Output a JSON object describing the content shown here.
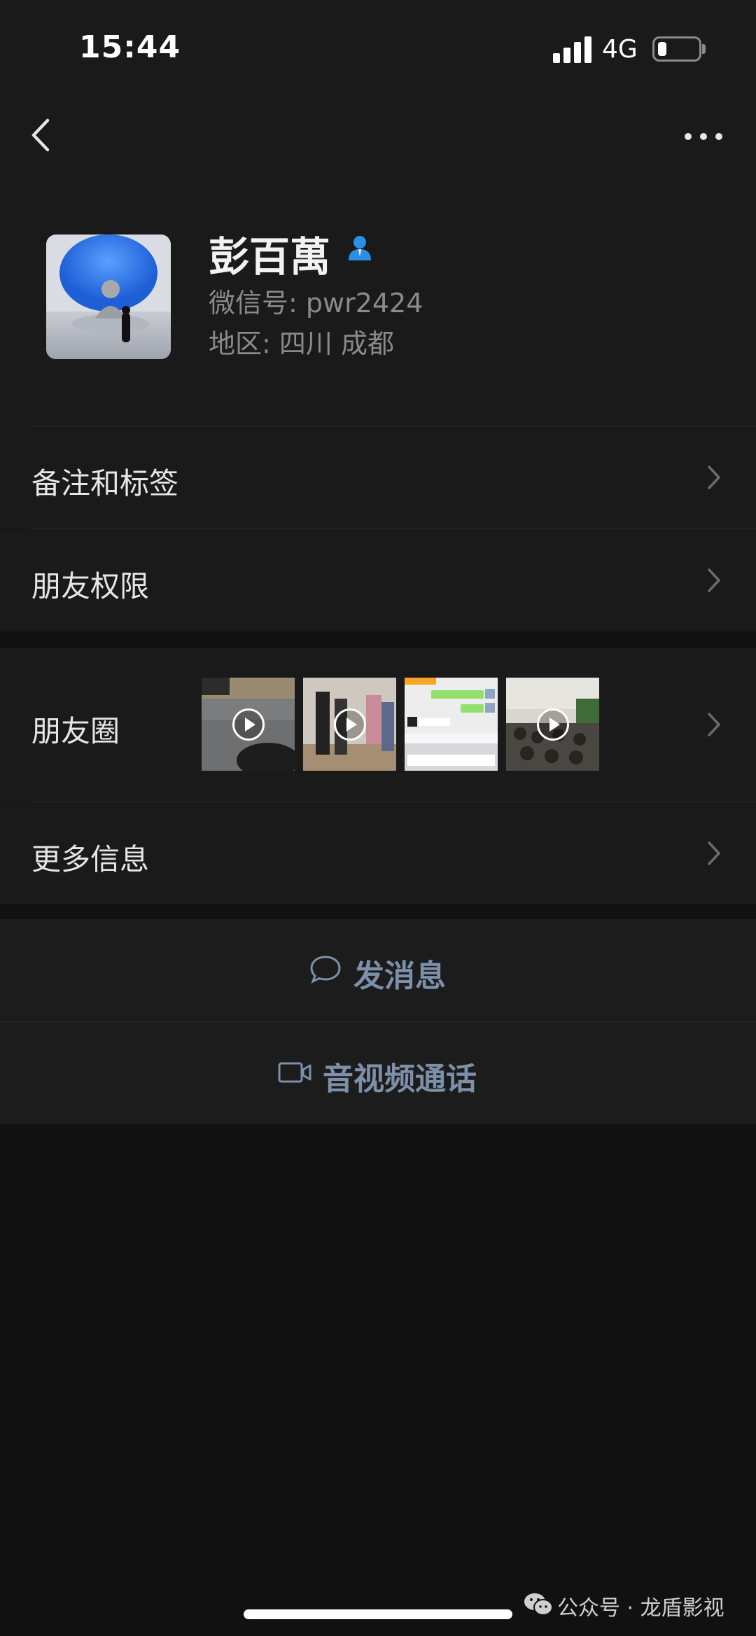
{
  "status_bar": {
    "time": "15:44",
    "network": "4G",
    "battery_level": 0.2
  },
  "profile": {
    "name": "彭百萬",
    "wechat_id": "微信号: pwr2424",
    "region": "地区: 四川 成都"
  },
  "menu": {
    "notes_tags": "备注和标签",
    "friend_permissions": "朋友权限",
    "moments": "朋友圈",
    "more_info": "更多信息"
  },
  "moments_thumbs": [
    {
      "type": "video",
      "icon": "play-icon"
    },
    {
      "type": "video",
      "icon": "play-icon"
    },
    {
      "type": "image",
      "icon": ""
    },
    {
      "type": "video",
      "icon": "play-icon"
    }
  ],
  "actions": {
    "send_message": "发消息",
    "video_call": "音视频通话"
  },
  "watermark": {
    "text": "公众号 · 龙盾影视"
  },
  "colors": {
    "background": "#111111",
    "panel": "#1a1a1a",
    "action_text": "#7d90a9",
    "verified_icon": "#2b8fe8"
  }
}
